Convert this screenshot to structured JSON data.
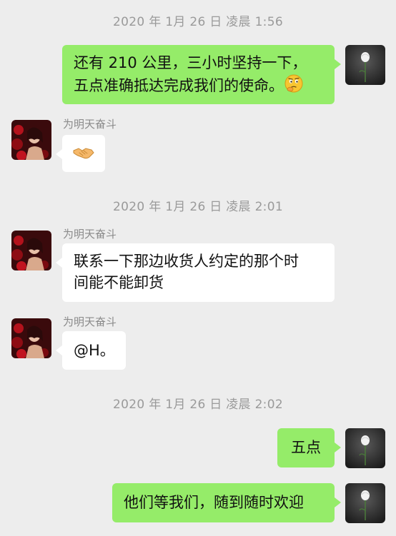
{
  "messages": [
    {
      "type": "timestamp",
      "text": "2020 年 1月 26 日 凌晨 1:56"
    },
    {
      "type": "outgoing",
      "line1": "还有 210 公里，三小时坚持一下，",
      "line2": "五点准确抵达完成我们的使命。",
      "emoji": "thinking-face-icon"
    },
    {
      "type": "incoming",
      "sender": "为明天奋斗",
      "emoji": "handshake-icon"
    },
    {
      "type": "timestamp",
      "text": "2020 年 1月 26 日 凌晨 2:01"
    },
    {
      "type": "incoming",
      "sender": "为明天奋斗",
      "line1": "联系一下那边收货人约定的那个时",
      "line2": "间能不能卸货"
    },
    {
      "type": "incoming",
      "sender": "为明天奋斗",
      "text": "@H。"
    },
    {
      "type": "timestamp",
      "text": "2020 年 1月 26 日 凌晨 2:02"
    },
    {
      "type": "outgoing",
      "text": "五点"
    },
    {
      "type": "outgoing",
      "text": "他们等我们，随到随时欢迎"
    }
  ],
  "colors": {
    "background": "#ededed",
    "outgoing_bubble": "#95ec69",
    "incoming_bubble": "#ffffff",
    "timestamp_text": "#9a9a9a",
    "sender_name": "#8a8a8a"
  }
}
